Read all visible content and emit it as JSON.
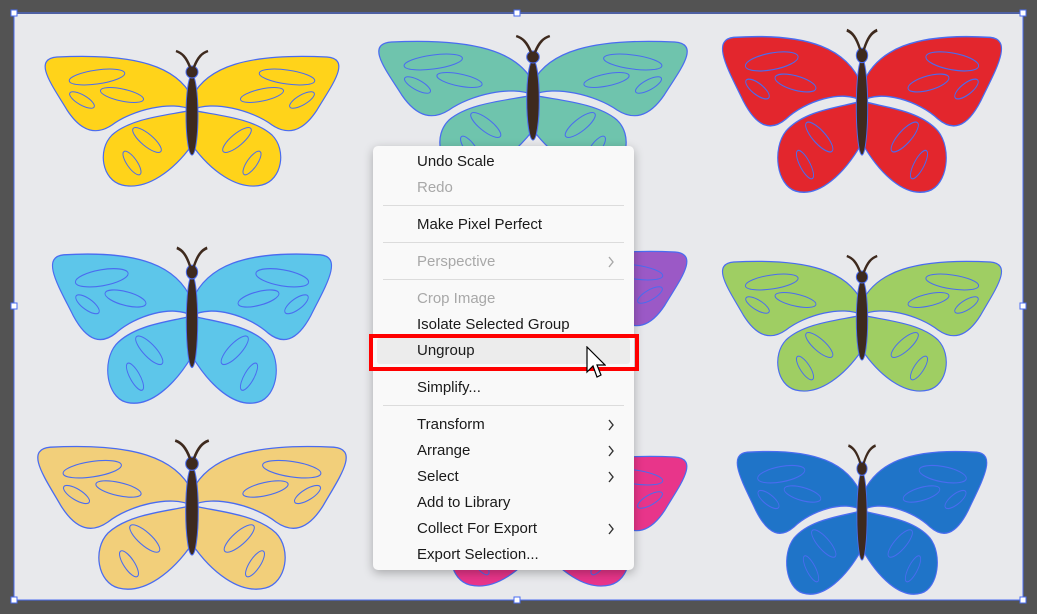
{
  "context_menu": {
    "items": {
      "undo_scale": "Undo Scale",
      "redo": "Redo",
      "make_pixel_perfect": "Make Pixel Perfect",
      "perspective": "Perspective",
      "crop_image": "Crop Image",
      "isolate_selected_group": "Isolate Selected Group",
      "ungroup": "Ungroup",
      "simplify": "Simplify...",
      "transform": "Transform",
      "arrange": "Arrange",
      "select": "Select",
      "add_to_library": "Add to Library",
      "collect_for_export": "Collect For Export",
      "export_selection": "Export Selection..."
    },
    "highlighted_item": "Ungroup",
    "highlight_color": "#ff0000"
  },
  "colors": {
    "artboard": "#e8e9ec",
    "pasteboard": "#535353",
    "selection": "#4a6cf0",
    "butterfly_yellow": "#ffd31a",
    "butterfly_teal": "#6fc4ad",
    "butterfly_red": "#e3262d",
    "butterfly_lightblue": "#5dc6ea",
    "butterfly_green": "#9fce63",
    "butterfly_sand": "#f2cf7a",
    "butterfly_blue": "#1f74c8",
    "butterfly_purple": "#9b59c6",
    "butterfly_pink": "#e8358a"
  }
}
